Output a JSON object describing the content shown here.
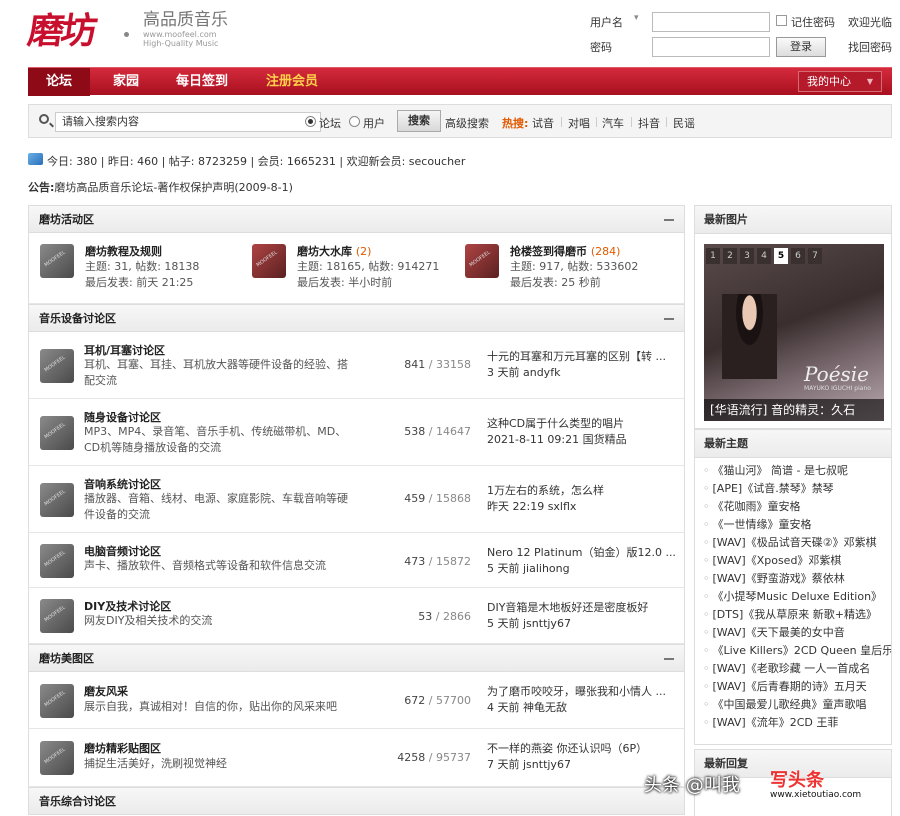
{
  "header": {
    "logo_main": "磨坊",
    "logo_cn": "高品质音乐",
    "logo_url": "www.moofeel.com",
    "logo_en": "High-Quality Music"
  },
  "login": {
    "username_label": "用户名",
    "select_arrow": "▾",
    "password_label": "密码",
    "remember": "记住密码",
    "welcome": "欢迎光临",
    "login_btn": "登录",
    "retrieve": "找回密码"
  },
  "nav": {
    "tabs": [
      "论坛",
      "家园",
      "每日签到",
      "注册会员"
    ],
    "center": "我的中心",
    "center_arrow": "▼"
  },
  "search": {
    "placeholder": "请输入搜索内容",
    "opt_forum": "论坛",
    "opt_user": "用户",
    "btn": "搜索",
    "advanced": "高级搜索",
    "hot_label": "热搜:",
    "hot_words": [
      "试音",
      "对唱",
      "汽车",
      "抖音",
      "民谣"
    ]
  },
  "stats": "今日: 380 | 昨日: 460 | 帖子: 8723259 | 会员: 1665231 | 欢迎新会员: secoucher",
  "notice": {
    "label": "公告:",
    "text": "磨坊高品质音乐论坛-著作权保护声明(2009-8-1)"
  },
  "categories": [
    {
      "title": "磨坊活动区"
    },
    {
      "title": "音乐设备讨论区"
    },
    {
      "title": "磨坊美图区"
    },
    {
      "title": "音乐综合讨论区"
    }
  ],
  "activity": [
    {
      "name": "磨坊教程及规则",
      "today": "",
      "stat": "主题: 31, 帖数: 18138",
      "last": "最后发表: 前天 21:25"
    },
    {
      "name": "磨坊大水库",
      "today": "(2)",
      "stat": "主题: 18165, 帖数: 914271",
      "last": "最后发表: 半小时前"
    },
    {
      "name": "抢楼签到得磨币",
      "today": "(284)",
      "stat": "主题: 917, 帖数: 533602",
      "last": "最后发表: 25 秒前"
    }
  ],
  "equipment": [
    {
      "name": "耳机/耳塞讨论区",
      "desc": "耳机、耳塞、耳挂、耳机放大器等硬件设备的经验、搭配交流",
      "threads": "841",
      "posts": "/ 33158",
      "last_title": "十元的耳塞和万元耳塞的区别【转 ...",
      "last_info": "3 天前 andyfk"
    },
    {
      "name": "随身设备讨论区",
      "desc": "MP3、MP4、录音笔、音乐手机、传统磁带机、MD、CD机等随身播放设备的交流",
      "threads": "538",
      "posts": "/ 14647",
      "last_title": "这种CD属于什么类型的唱片",
      "last_info": "2021-8-11 09:21 国货精品"
    },
    {
      "name": "音响系统讨论区",
      "desc": "播放器、音箱、线材、电源、家庭影院、车载音响等硬件设备的交流",
      "threads": "459",
      "posts": "/ 15868",
      "last_title": "1万左右的系统，怎么样",
      "last_info": "昨天 22:19 sxlflx"
    },
    {
      "name": "电脑音频讨论区",
      "desc": "声卡、播放软件、音频格式等设备和软件信息交流",
      "threads": "473",
      "posts": "/ 15872",
      "last_title": "Nero 12 Platinum（铂金）版12.0 ...",
      "last_info": "5 天前 jialihong"
    },
    {
      "name": "DIY及技术讨论区",
      "desc": "网友DIY及相关技术的交流",
      "threads": "53",
      "posts": "/ 2866",
      "last_title": "DIY音箱是木地板好还是密度板好",
      "last_info": "5 天前 jsnttjy67"
    }
  ],
  "photo": [
    {
      "name": "磨友风采",
      "desc": "展示自我，真诚相对！自信的你，贴出你的风采来吧",
      "threads": "672",
      "posts": "/ 57700",
      "last_title": "为了磨币咬咬牙，曝张我和小情人 ...",
      "last_info": "4 天前 神龟无敌"
    },
    {
      "name": "磨坊精彩贴图区",
      "desc": "捕捉生活美好，洗刷视觉神经",
      "threads": "4258",
      "posts": "/ 95737",
      "last_title": "不一样的燕姿 你还认识吗（6P）",
      "last_info": "7 天前 jsnttjy67"
    }
  ],
  "sidebar": {
    "pics_title": "最新图片",
    "slide_nums": [
      "1",
      "2",
      "3",
      "4",
      "5",
      "6",
      "7"
    ],
    "slide_poesie": "Poésie",
    "slide_artist": "MAYUKO IGUCHI piano",
    "slide_caption": "[华语流行] 音的精灵：久石",
    "topics_title": "最新主题",
    "topics": [
      "《猫山河》 简谱 - 是七叔呢",
      "[APE]《试音.禁琴》禁琴",
      "《花咖雨》童安格",
      "《一世情缘》童安格",
      "[WAV]《极品试音天碟②》邓紫棋",
      "[WAV]《Xposed》邓紫棋",
      "[WAV]《野蛮游戏》蔡依林",
      "《小提琴Music Deluxe Edition》",
      "[DTS]《我从草原来 新歌+精选》",
      "[WAV]《天下最美的女中音",
      "《Live Killers》2CD Queen 皇后乐",
      "[WAV]《老歌珍藏 一人一首成名",
      "[WAV]《后青春期的诗》五月天",
      "《中国最爱儿歌经典》童声歌唱",
      "[WAV]《流年》2CD 王菲"
    ],
    "replies_title": "最新回复"
  },
  "watermark": {
    "a": "头条 @叫我",
    "b": "写头条",
    "c": "www.xietoutiao.com"
  }
}
